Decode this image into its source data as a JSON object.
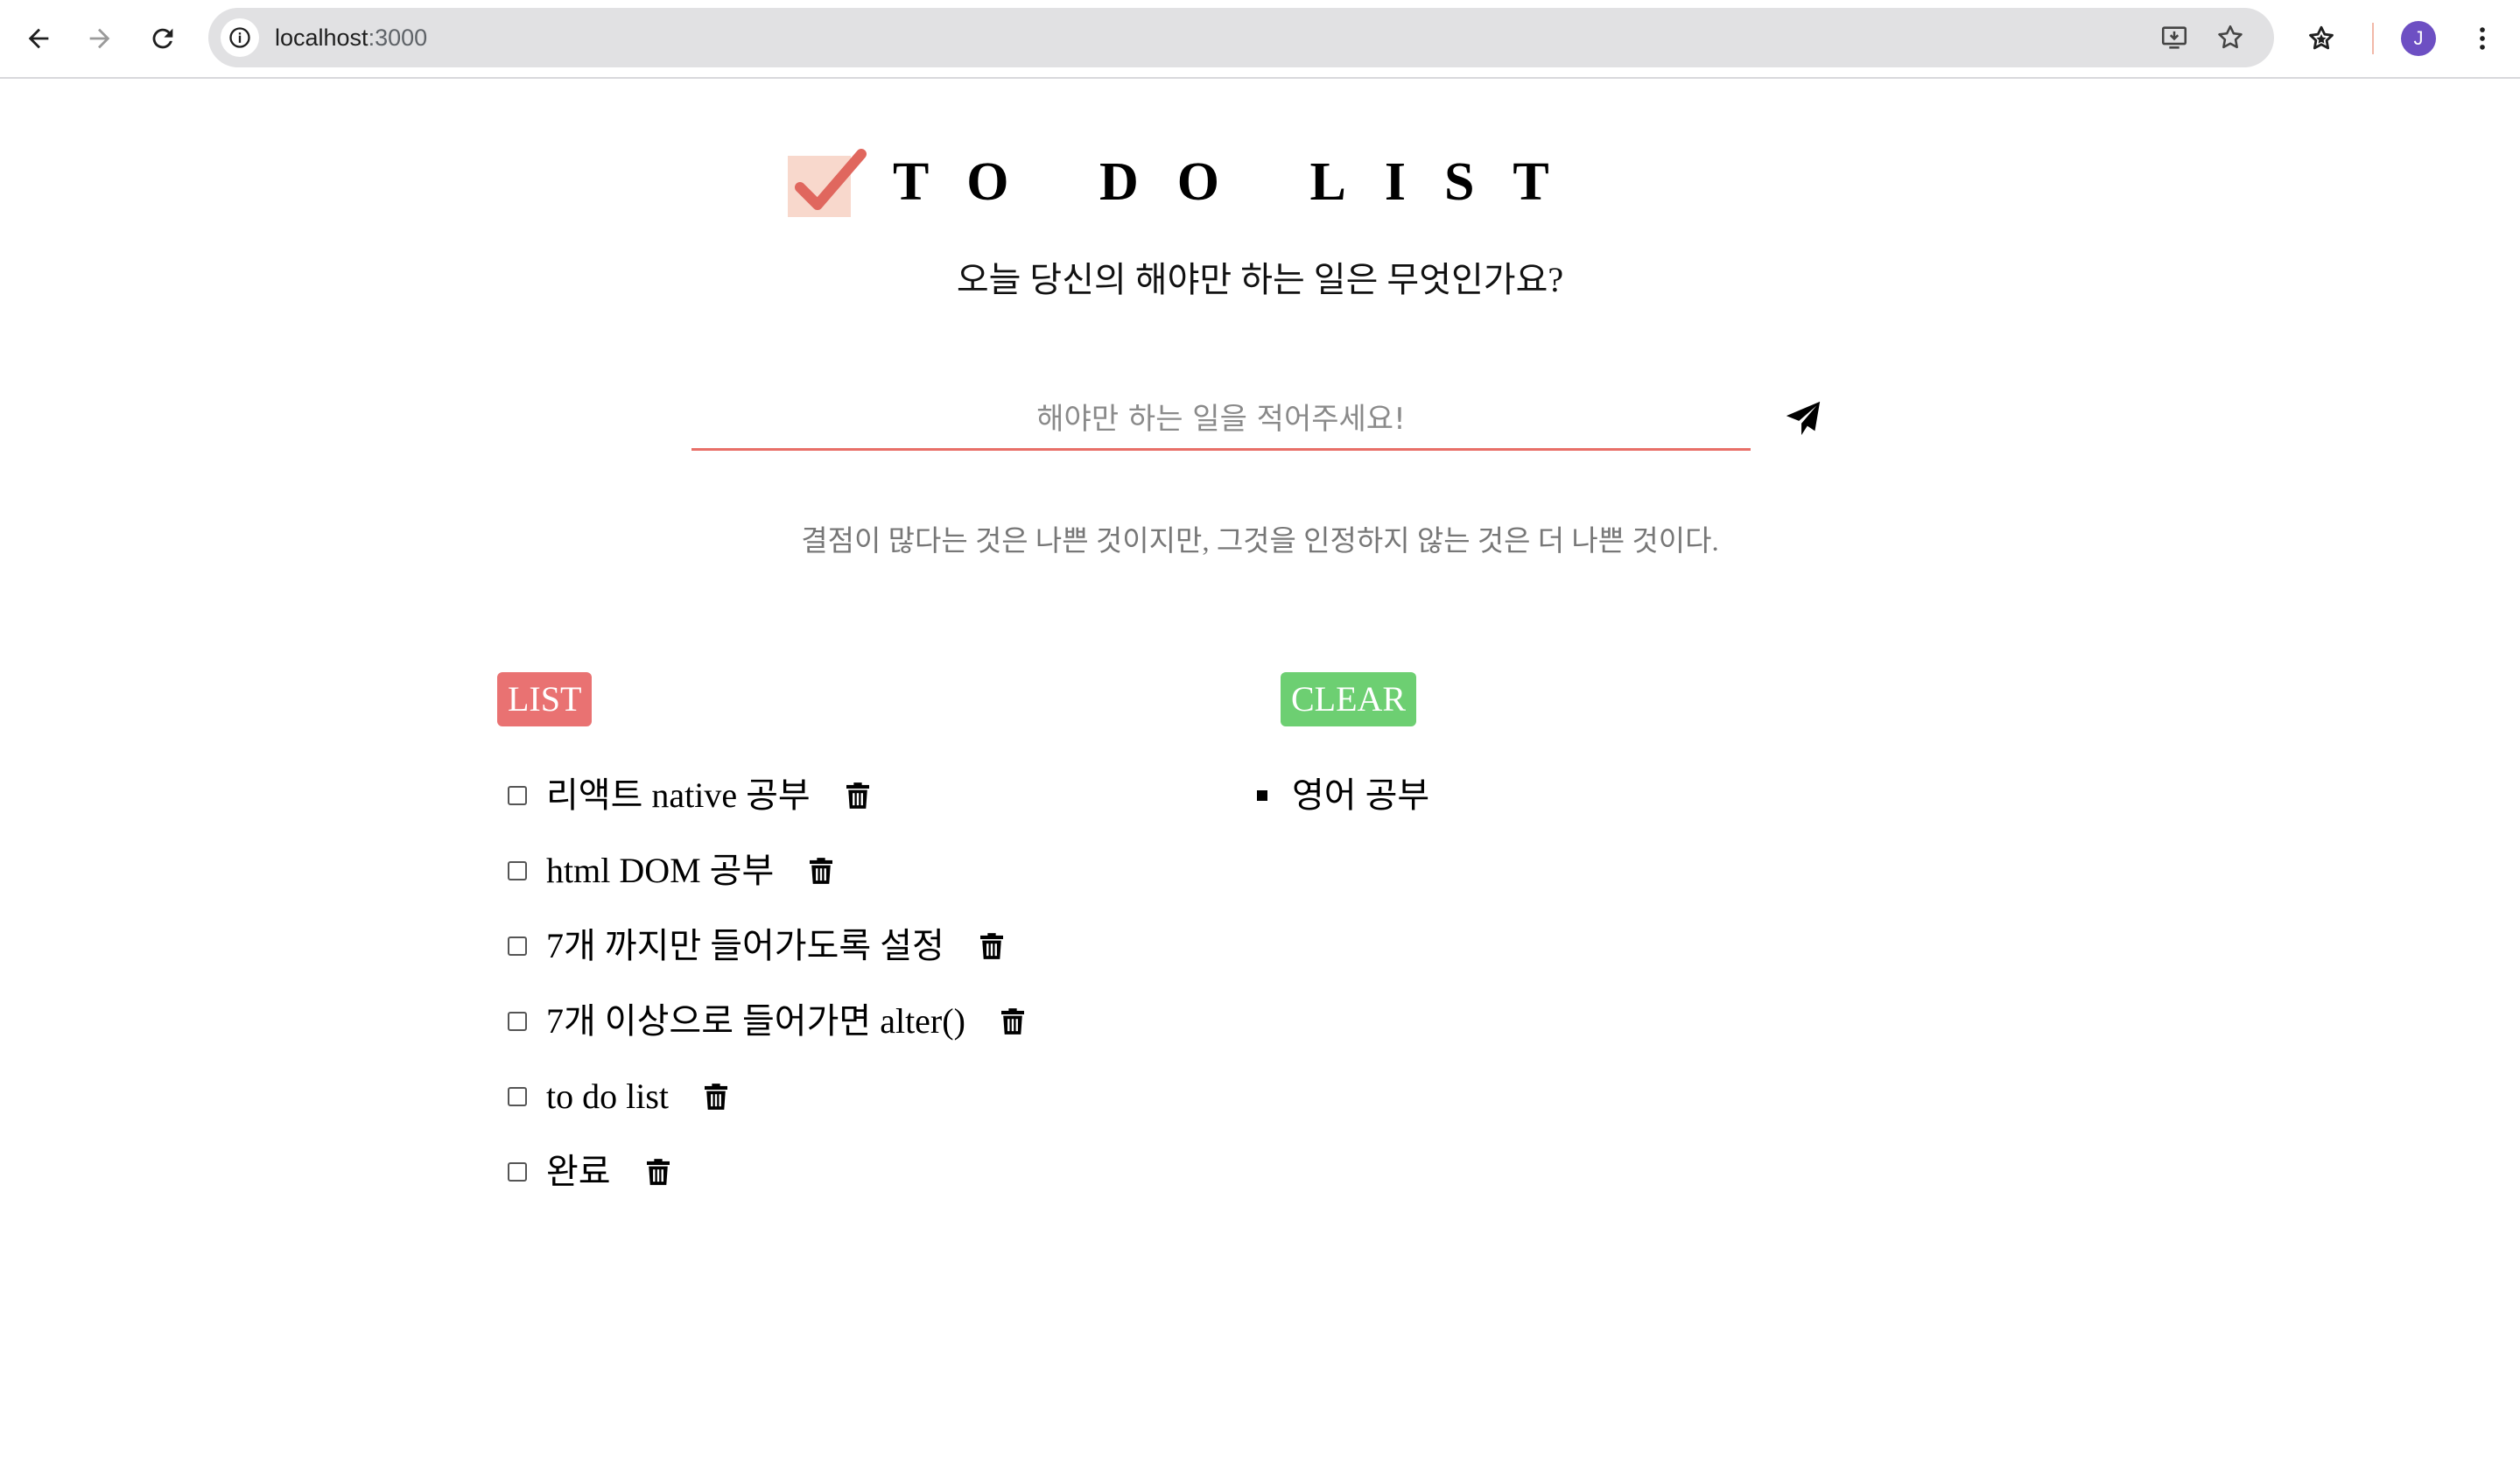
{
  "browser": {
    "url_host": "localhost",
    "url_port": ":3000",
    "avatar_letter": "J",
    "avatar_color": "#6d4fc3"
  },
  "header": {
    "title": "TO DO LIST",
    "subtitle": "오늘 당신의 해야만 하는 일은 무엇인가요?",
    "logo_icon": "checkbox-check-icon"
  },
  "input": {
    "placeholder": "해야만 하는 일을 적어주세요!",
    "value": "",
    "submit_icon": "paper-plane-icon"
  },
  "quote": "결점이 많다는 것은 나쁜 것이지만, 그것을 인정하지 않는 것은 더 나쁜 것이다.",
  "list_section": {
    "label": "LIST",
    "color": "#e97272",
    "items": [
      {
        "text": "리액트 native 공부",
        "checked": false
      },
      {
        "text": "html DOM 공부",
        "checked": false
      },
      {
        "text": "7개 까지만 들어가도록 설정",
        "checked": false
      },
      {
        "text": "7개 이상으로 들어가면 alter()",
        "checked": false
      },
      {
        "text": "to do list",
        "checked": false
      },
      {
        "text": "완료",
        "checked": false
      }
    ]
  },
  "clear_section": {
    "label": "CLEAR",
    "color": "#6dcf72",
    "items": [
      {
        "text": "영어 공부"
      }
    ]
  },
  "colors": {
    "accent_red": "#e86f68",
    "logo_bg": "#f8d8cc",
    "logo_check": "#e0675e"
  }
}
